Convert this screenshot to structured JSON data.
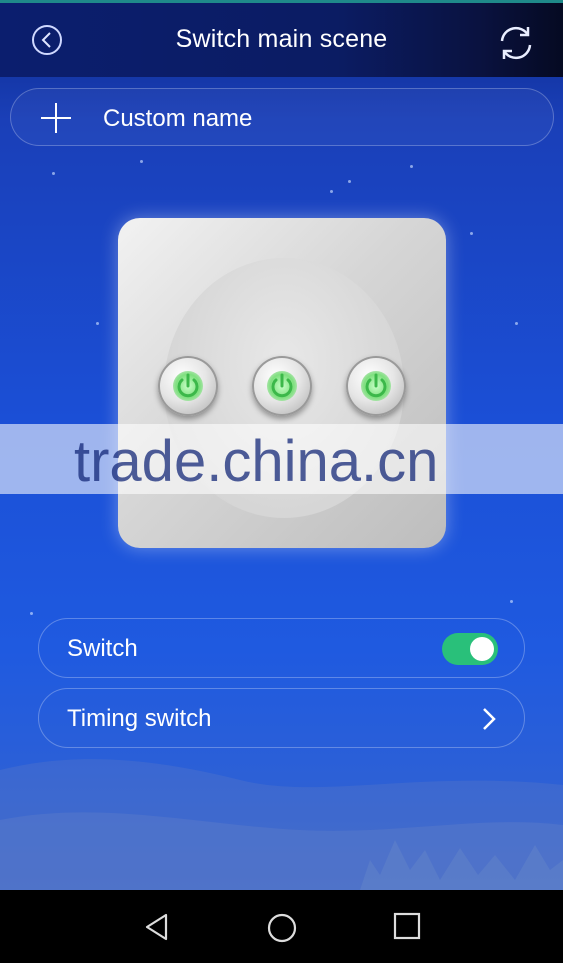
{
  "header": {
    "title": "Switch main scene",
    "back_icon": "chevron-left-circle-icon",
    "refresh_icon": "refresh-icon"
  },
  "name_row": {
    "label": "Custom name",
    "icon": "plus-icon"
  },
  "device": {
    "buttons": [
      {
        "icon": "power-icon",
        "state": "on"
      },
      {
        "icon": "power-icon",
        "state": "on"
      },
      {
        "icon": "power-icon",
        "state": "on"
      }
    ]
  },
  "watermark": {
    "text": "trade.china.cn"
  },
  "settings": {
    "switch_label": "Switch",
    "switch_on": true,
    "timing_label": "Timing switch",
    "timing_icon": "chevron-right-icon"
  },
  "navbar": {
    "back_icon": "triangle-back-icon",
    "home_icon": "circle-home-icon",
    "recents_icon": "square-recents-icon"
  },
  "colors": {
    "header_bg": "#0b1c63",
    "toggle_on": "#29c07a",
    "power_green": "#3cb84a"
  }
}
